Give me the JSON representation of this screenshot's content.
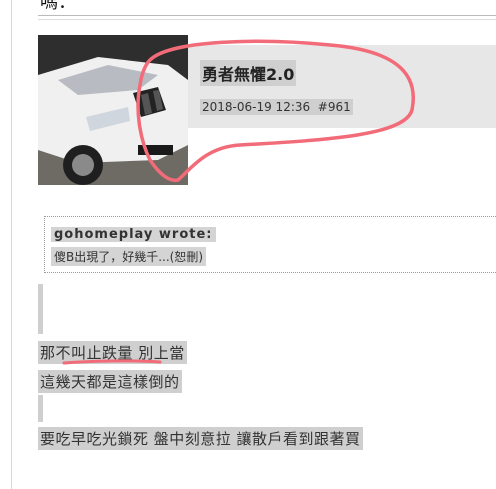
{
  "header": {
    "title_fragment": "嗎："
  },
  "post": {
    "username": "勇者無懼2.0",
    "date": "2018-06-19 12:36",
    "post_number": "#961"
  },
  "quote": {
    "author": "gohomeplay wrote:",
    "text": "傻B出現了，好幾千...(恕刪)"
  },
  "body": {
    "line1": "那不叫止跌量 別上當",
    "line2": "這幾天都是這樣倒的",
    "line3": "要吃早吃光鎖死 盤中刻意拉 讓散戶看到跟著買"
  },
  "colors": {
    "annotation": "#f26b78",
    "selection": "#cfcfcf",
    "info_bg": "#e7e7e7"
  },
  "icons": [
    "avatar-car-photo"
  ]
}
